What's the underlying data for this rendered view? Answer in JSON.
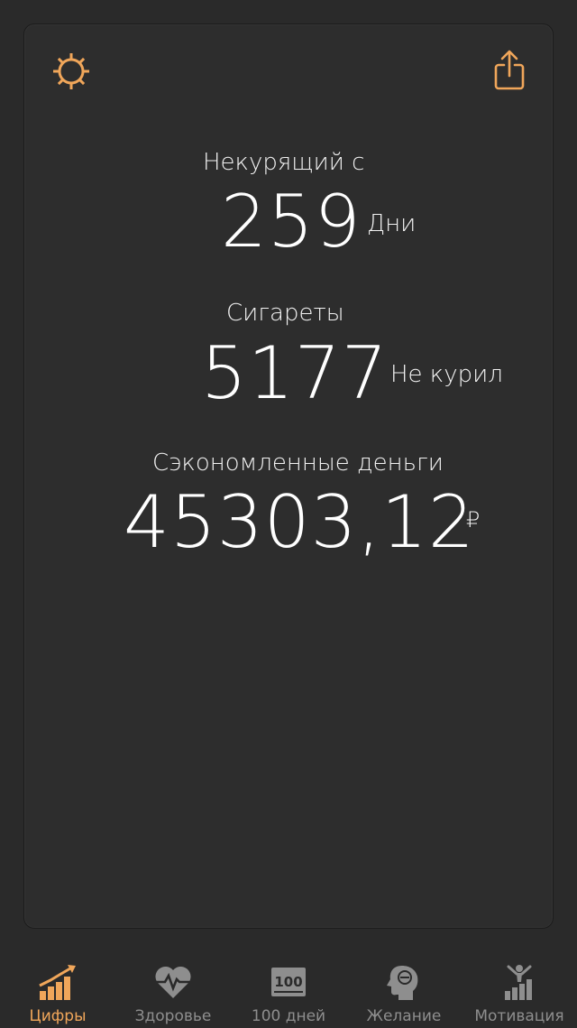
{
  "colors": {
    "accent": "#f0a65a",
    "background": "#2a2a2a",
    "inactive": "#8e8e8e"
  },
  "header": {
    "settings_icon": "gear-icon",
    "share_icon": "share-icon"
  },
  "stats": {
    "smokefree": {
      "label": "Некурящий с",
      "value": "259",
      "unit": "Дни"
    },
    "cigarettes": {
      "label": "Сигареты",
      "value": "5177",
      "unit": "Не курил"
    },
    "money": {
      "label": "Сэкономленные деньги",
      "value": "45303,12",
      "unit": "₽"
    }
  },
  "tabbar": {
    "tabs": [
      {
        "label": "Цифры",
        "icon": "chart-icon",
        "active": true
      },
      {
        "label": "Здоровье",
        "icon": "heart-pulse-icon",
        "active": false
      },
      {
        "label": "100 дней",
        "icon": "hundred-icon",
        "active": false
      },
      {
        "label": "Желание",
        "icon": "head-icon",
        "active": false
      },
      {
        "label": "Мотивация",
        "icon": "motivation-icon",
        "active": false
      }
    ]
  }
}
